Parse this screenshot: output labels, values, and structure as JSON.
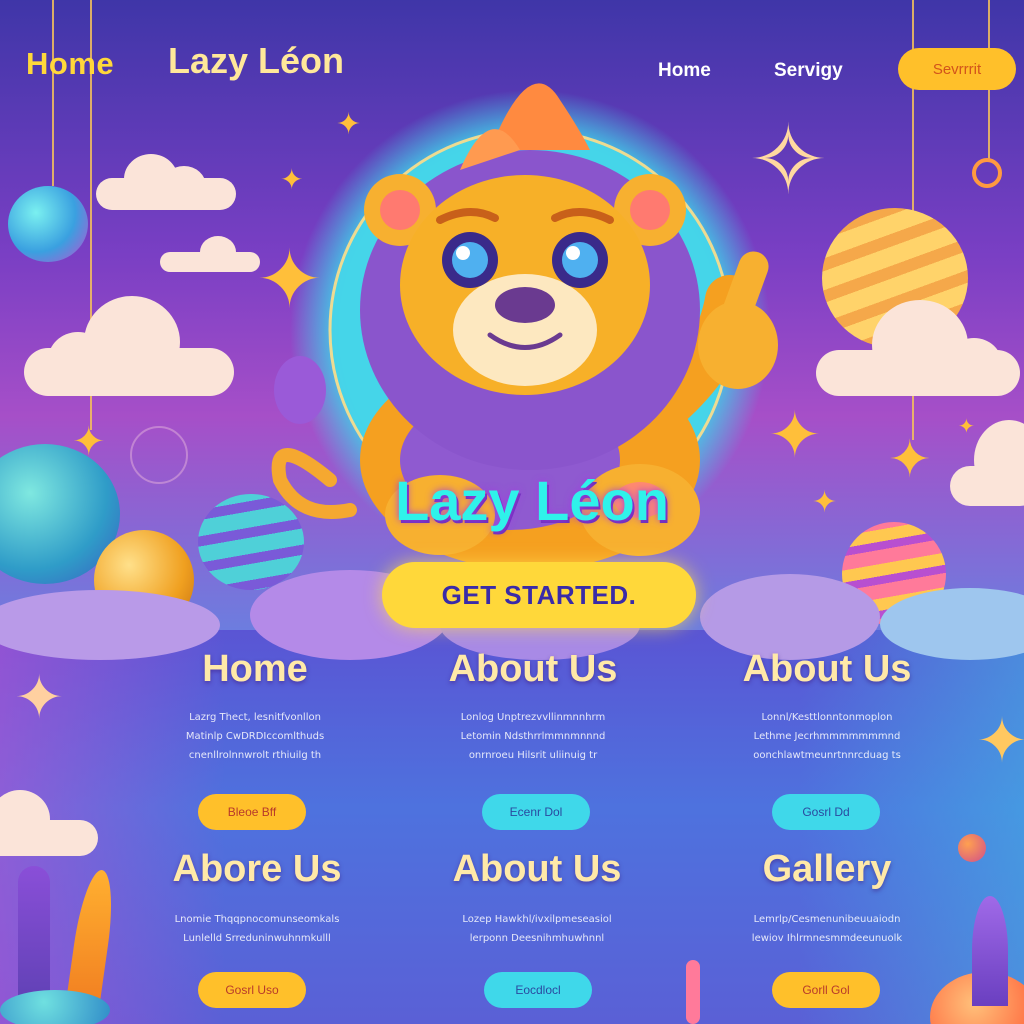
{
  "nav": {
    "home_big": "Home",
    "brand": "Lazy Léon",
    "links": [
      "Home",
      "Servigy"
    ],
    "cta": "Sevrrrit"
  },
  "hero": {
    "title": "Lazy Léon",
    "cta": "GET STARTED."
  },
  "cards": [
    {
      "title": "Home",
      "lines": [
        "Lazrg Thect, lesnitfvonllon",
        "Matinlp CwDRDIccomlthuds",
        "cnenllrolnnwrolt rthiuilg th"
      ],
      "button": "Bleoe Bff"
    },
    {
      "title": "About Us",
      "lines": [
        "Lonlog Unptrezvvllinmnnhrm",
        "Letomin Ndsthrrlmmnmnnnd",
        "onrnroeu Hilsrit uliinuig tr"
      ],
      "button": "Ecenr Dol"
    },
    {
      "title": "About Us",
      "lines": [
        "Lonnl/Kesttlonntonmoplon",
        "Lethme Jecrhmmmmmmmnd",
        "oonchlawtmeunrtnnrcduag ts"
      ],
      "button": "Gosrl Dd"
    },
    {
      "title": "Abore Us",
      "lines": [
        "Lnomie Thqqpnocomunseomkals",
        "Lunlelld Srreduninwuhnmkulll"
      ],
      "button": "Gosrl Uso"
    },
    {
      "title": "About Us",
      "lines": [
        "Lozep Hawkhl/ivxilpmeseasiol",
        "lerponn Deesnihmhuwhnnl"
      ],
      "button": "Eocdlocl"
    },
    {
      "title": "Gallery",
      "lines": [
        "Lemrlp/Cesmenunibeuuaiodn",
        "lewiov Ihlrmnesmmdeeunuolk"
      ],
      "button": "Gorll Gol"
    }
  ]
}
